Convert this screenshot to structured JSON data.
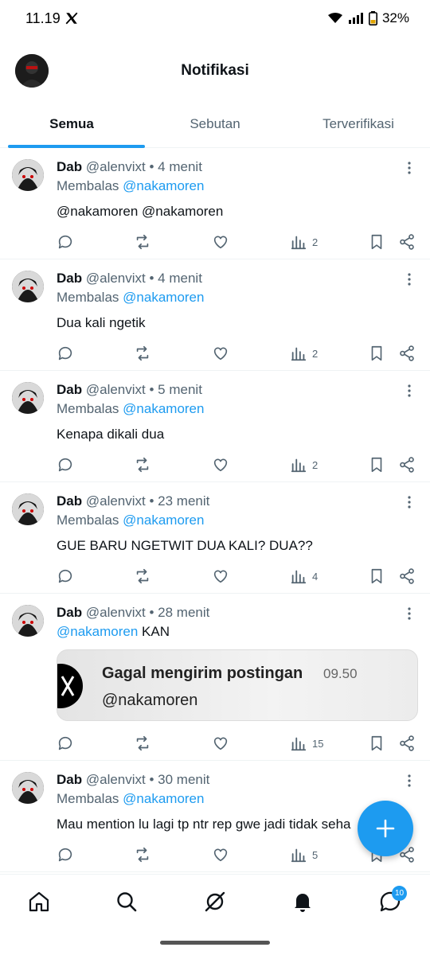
{
  "status": {
    "time": "11.19",
    "battery": "32%"
  },
  "header": {
    "title": "Notifikasi"
  },
  "tabs": [
    {
      "label": "Semua",
      "active": true
    },
    {
      "label": "Sebutan",
      "active": false
    },
    {
      "label": "Terverifikasi",
      "active": false
    }
  ],
  "posts": [
    {
      "name": "Dab",
      "handle": "@alenvixt",
      "time": "• 4 menit",
      "reply_prefix": "Membalas",
      "reply_to": "@nakamoren",
      "text_mentions": "@nakamoren @nakamoren",
      "views": "2"
    },
    {
      "name": "Dab",
      "handle": "@alenvixt",
      "time": "• 4 menit",
      "reply_prefix": "Membalas",
      "reply_to": "@nakamoren",
      "text": "Dua kali ngetik",
      "views": "2"
    },
    {
      "name": "Dab",
      "handle": "@alenvixt",
      "time": "• 5 menit",
      "reply_prefix": "Membalas",
      "reply_to": "@nakamoren",
      "text": "Kenapa dikali dua",
      "views": "2"
    },
    {
      "name": "Dab",
      "handle": "@alenvixt",
      "time": "• 23 menit",
      "reply_prefix": "Membalas",
      "reply_to": "@nakamoren",
      "text": "GUE BARU NGETWIT DUA KALI? DUA??",
      "views": "4"
    },
    {
      "name": "Dab",
      "handle": "@alenvixt",
      "time": "• 28 menit",
      "line_mention": "@nakamoren",
      "line_text": "KAN",
      "card": {
        "title": "Gagal mengirim postingan",
        "time": "09.50",
        "handle": "@nakamoren"
      },
      "views": "15"
    },
    {
      "name": "Dab",
      "handle": "@alenvixt",
      "time": "• 30 menit",
      "reply_prefix": "Membalas",
      "reply_to": "@nakamoren",
      "text": "Mau mention lu lagi tp ntr rep gwe jadi tidak seha",
      "views": "5"
    }
  ],
  "nav": {
    "messages_badge": "10"
  },
  "icons": [
    "x-logo-icon",
    "wifi-icon",
    "signal-icon",
    "battery-icon",
    "more-icon",
    "reply-icon",
    "retweet-icon",
    "like-icon",
    "views-icon",
    "bookmark-icon",
    "share-icon",
    "plus-icon",
    "home-icon",
    "search-icon",
    "grok-icon",
    "bell-icon",
    "messages-icon"
  ],
  "colors": {
    "accent": "#1d9bf0",
    "text": "#0f1419",
    "secondary": "#536471"
  }
}
